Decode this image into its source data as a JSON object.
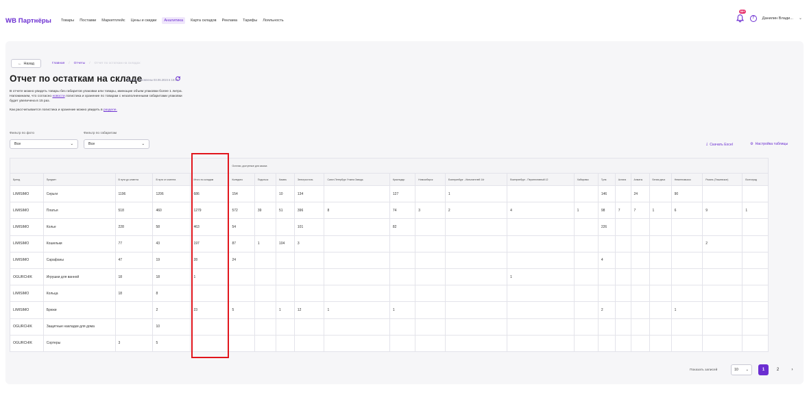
{
  "header": {
    "logo": "WB Партнёры",
    "nav": [
      "Товары",
      "Поставки",
      "Маркетплейс",
      "Цены и скидки",
      "Аналитика",
      "Карта складов",
      "Реклама",
      "Тарифы",
      "Лояльность"
    ],
    "active_nav": "Аналитика",
    "notification_badge": "99+",
    "help": "?",
    "user_name": "Данилин Влади..."
  },
  "page": {
    "back_label": "Назад",
    "breadcrumbs": [
      "Главная",
      "Отчеты",
      "Отчет по остаткам на складах"
    ],
    "title": "Отчет по остаткам на складе",
    "updated": "Данные обновлены 03.06.2024 в 16:57",
    "desc_line1": "В отчете можно увидеть товары без габаритов упаковки или товары, имеющие объем упаковки более 1 литра.",
    "desc_line2_before": "Напоминаем, что согласно ",
    "desc_line2_link": "новости",
    "desc_line2_after": " логистика и хранение по товарам с незаполненными габаритами упаковки",
    "desc_line3": "будет увеличена в 15 раз.",
    "desc_line4_before": "Как рассчитывается логистика и хранение можно увидеть в ",
    "desc_line4_link": "разделе."
  },
  "filters": {
    "photo_label": "Фильтр по фото",
    "photo_value": "Все",
    "size_label": "Фильтр по габаритам",
    "size_value": "Все"
  },
  "tools": {
    "download": "Скачать Excel",
    "settings": "Настройка таблицы"
  },
  "table": {
    "group_header": "Остатки, доступные для заказа",
    "columns": [
      "Бренд",
      "Предмет",
      "В пути до клиента",
      "В пути от клиента",
      "Итого по складам",
      "Коледино",
      "Подольск",
      "Казань",
      "Электросталь",
      "Санкт-Петербург Уткина Заводь",
      "Краснодар",
      "Новосибирск",
      "Екатеринбург - Испытателей 14г",
      "Екатеринбург - Перспективный 12",
      "Хабаровск",
      "Тула",
      "Астана",
      "Алматы",
      "Белая дача",
      "Невинномысск",
      "Рязань (Тюшевское)",
      "Волгоград"
    ],
    "rows": [
      [
        "LIMISIMO",
        "Серьги",
        "1196",
        "1206",
        "686",
        "154",
        "",
        "10",
        "134",
        "",
        "127",
        "",
        "1",
        "",
        "",
        "146",
        "",
        "24",
        "",
        "90",
        "",
        ""
      ],
      [
        "LIMISIMO",
        "Платья",
        "518",
        "460",
        "1279",
        "572",
        "39",
        "51",
        "396",
        "8",
        "74",
        "3",
        "2",
        "4",
        "1",
        "98",
        "7",
        "7",
        "1",
        "6",
        "9",
        "1"
      ],
      [
        "LIMISIMO",
        "Колье",
        "228",
        "58",
        "463",
        "54",
        "",
        "",
        "101",
        "",
        "82",
        "",
        "",
        "",
        "",
        "226",
        "",
        "",
        "",
        "",
        "",
        ""
      ],
      [
        "LIMISIMO",
        "Кошельки",
        "77",
        "43",
        "197",
        "87",
        "1",
        "104",
        "3",
        "",
        "",
        "",
        "",
        "",
        "",
        "",
        "",
        "",
        "",
        "",
        "2",
        ""
      ],
      [
        "LIMISIMO",
        "Сарафаны",
        "47",
        "19",
        "28",
        "24",
        "",
        "",
        "",
        "",
        "",
        "",
        "",
        "",
        "",
        "4",
        "",
        "",
        "",
        "",
        "",
        ""
      ],
      [
        "OGURCHIK",
        "Игрушки для ванной",
        "18",
        "18",
        "1",
        "",
        "",
        "",
        "",
        "",
        "",
        "",
        "",
        "1",
        "",
        "",
        "",
        "",
        "",
        "",
        "",
        ""
      ],
      [
        "LIMISIMO",
        "Кольца",
        "18",
        "8",
        "",
        "",
        "",
        "",
        "",
        "",
        "",
        "",
        "",
        "",
        "",
        "",
        "",
        "",
        "",
        "",
        "",
        ""
      ],
      [
        "LIMISIMO",
        "Брюки",
        "",
        "2",
        "23",
        "5",
        "",
        "1",
        "12",
        "1",
        "1",
        "",
        "",
        "",
        "",
        "2",
        "",
        "",
        "",
        "1",
        "",
        ""
      ],
      [
        "OGURCHIK",
        "Защитные накладки для дома",
        "",
        "10",
        "",
        "",
        "",
        "",
        "",
        "",
        "",
        "",
        "",
        "",
        "",
        "",
        "",
        "",
        "",
        "",
        "",
        ""
      ],
      [
        "OGURCHIK",
        "Сортеры",
        "3",
        "5",
        "",
        "",
        "",
        "",
        "",
        "",
        "",
        "",
        "",
        "",
        "",
        "",
        "",
        "",
        "",
        "",
        "",
        ""
      ]
    ]
  },
  "pagination": {
    "label": "Показать записей",
    "per_page": "10",
    "pages": [
      "1",
      "2"
    ],
    "current": "1",
    "next": "›"
  },
  "colors": {
    "accent": "#6b2ed1",
    "highlight": "#e1141b"
  }
}
